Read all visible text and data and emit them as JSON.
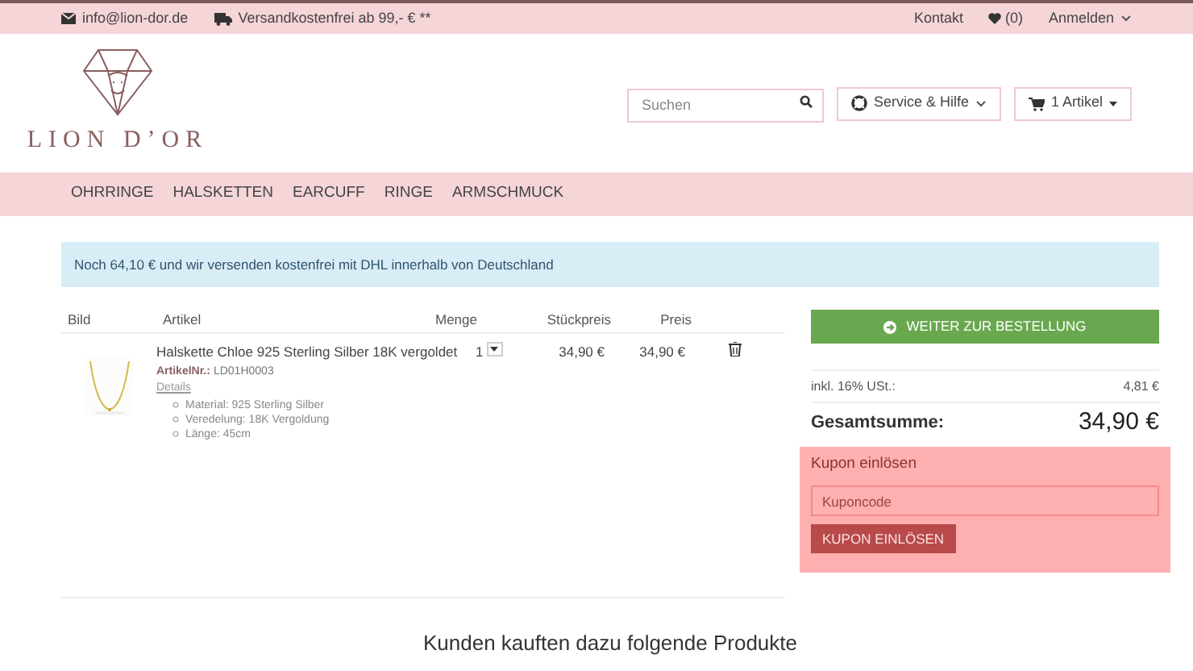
{
  "topbar": {
    "email": "info@lion-dor.de",
    "shipping": "Versandkostenfrei ab 99,- € **",
    "contact": "Kontakt",
    "wishlist": "(0)",
    "login": "Anmelden"
  },
  "header": {
    "logo_text": "LION D’OR",
    "search": {
      "placeholder": "Suchen"
    },
    "service": "Service & Hilfe",
    "cart": "1 Artikel"
  },
  "nav": {
    "items": [
      "OHRRINGE",
      "HALSKETTEN",
      "EARCUFF",
      "RINGE",
      "ARMSCHMUCK"
    ]
  },
  "notice": "Noch 64,10 € und wir versenden kostenfrei mit DHL innerhalb von Deutschland",
  "cart": {
    "columns": [
      "Bild",
      "Artikel",
      "Menge",
      "Stückpreis",
      "Preis"
    ],
    "rows": [
      {
        "name": "Halskette Chloe 925 Sterling Silber 18K vergoldet",
        "article_label": "ArtikelNr.:",
        "article_no": "LD01H0003",
        "details": "Details",
        "attributes": [
          "Material: 925 Sterling Silber",
          "Veredelung: 18K Vergoldung",
          "Länge: 45cm"
        ],
        "quantity": "1",
        "unit_price": "34,90 €",
        "price": "34,90 €"
      }
    ]
  },
  "summary": {
    "checkout": "WEITER ZUR BESTELLUNG",
    "tax_label": "inkl. 16% USt.:",
    "tax": "4,81 €",
    "total_label": "Gesamtsumme:",
    "total": "34,90 €"
  },
  "coupon": {
    "title": "Kupon einlösen",
    "placeholder": "Kuponcode",
    "button": "KUPON EINLÖSEN"
  },
  "recommendations": {
    "title": "Kunden kauften dazu folgende Produkte"
  }
}
